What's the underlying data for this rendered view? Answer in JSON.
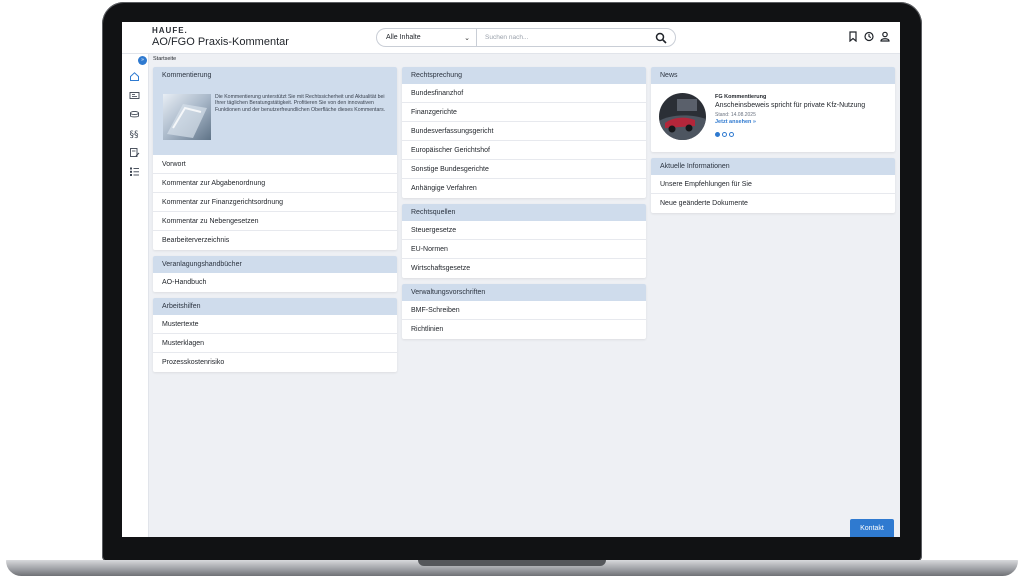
{
  "app": {
    "brand_logo": "HAUFE.",
    "title": "AO/FGO Praxis-Kommentar"
  },
  "search": {
    "scope": "Alle Inhalte",
    "placeholder": "Suchen nach..."
  },
  "breadcrumb": "Startseite",
  "kommentierung": {
    "heading": "Kommentierung",
    "intro": "Die Kommentierung unterstützt Sie mit Rechtssicherheit und Aktualität bei Ihrer täglichen Beratungstätigkeit. Profitieren Sie von den innovativen Funktionen und der benutzerfreundlichen Oberfläche dieses Kommentars.",
    "items": [
      "Vorwort",
      "Kommentar zur Abgabenordnung",
      "Kommentar zur Finanzgerichtsordnung",
      "Kommentar zu Nebengesetzen",
      "Bearbeiterverzeichnis"
    ]
  },
  "veranlagung": {
    "heading": "Veranlagungshandbücher",
    "items": [
      "AO-Handbuch"
    ]
  },
  "arbeitshilfen": {
    "heading": "Arbeitshilfen",
    "items": [
      "Mustertexte",
      "Musterklagen",
      "Prozesskostenrisiko"
    ]
  },
  "rechtsprechung": {
    "heading": "Rechtsprechung",
    "items": [
      "Bundesfinanzhof",
      "Finanzgerichte",
      "Bundesverfassungsgericht",
      "Europäischer Gerichtshof",
      "Sonstige Bundesgerichte",
      "Anhängige Verfahren"
    ]
  },
  "rechtsquellen": {
    "heading": "Rechtsquellen",
    "items": [
      "Steuergesetze",
      "EU-Normen",
      "Wirtschaftsgesetze"
    ]
  },
  "verwaltung": {
    "heading": "Verwaltungsvorschriften",
    "items": [
      "BMF-Schreiben",
      "Richtlinien"
    ]
  },
  "news": {
    "heading": "News",
    "category": "FG Kommentierung",
    "title": "Anscheinsbeweis spricht für private Kfz-Nutzung",
    "date": "Stand: 14.08.2025",
    "link": "Jetzt ansehen »",
    "active_slide": 1,
    "slides": 3
  },
  "aktuelle": {
    "heading": "Aktuelle Informationen",
    "items": [
      "Unsere Empfehlungen für Sie",
      "Neue geänderte Dokumente"
    ]
  },
  "kontakt": "Kontakt",
  "colors": {
    "accent": "#2f7ad0",
    "card_header": "#cfdcec",
    "background": "#eef0f4"
  }
}
